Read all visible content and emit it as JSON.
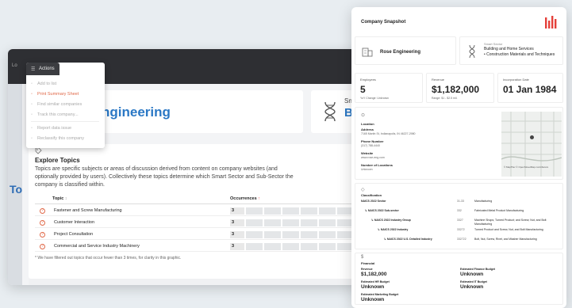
{
  "back": {
    "topbar_text": "Lo",
    "side_letter": "To",
    "company_name_partial": "ngineering",
    "sector_label_partial": "Sn",
    "sector_value_partial": "Bu"
  },
  "actions": {
    "button_label": "Actions",
    "items": [
      {
        "label": "Add to list",
        "active": false
      },
      {
        "label": "Print Summary Sheet",
        "active": true
      },
      {
        "label": "Find similar companies",
        "active": false
      },
      {
        "label": "Track this company...",
        "active": false
      },
      {
        "label": "Report data issue",
        "active": false
      },
      {
        "label": "Reclassify this company",
        "active": false
      }
    ]
  },
  "topics": {
    "title": "Explore Topics",
    "description": "Topics are specific subjects or areas of discussion derived from content on company websites (and optionally provided by users). Collectively these topics determine which Smart Sector and Sub-Sector the company is classified within.",
    "col_topic": "Topic",
    "col_occurrences": "Occurrences",
    "sort_arrow": "↑",
    "rows": [
      {
        "topic": "Fastener and Screw Manufacturing",
        "count": "3"
      },
      {
        "topic": "Customer Interaction",
        "count": "3"
      },
      {
        "topic": "Project Consultation",
        "count": "3"
      },
      {
        "topic": "Commercial and Service Industry Machinery",
        "count": "3"
      }
    ],
    "footnote": "* We have filtered out topics that occur fewer than 3 times, for clarity in this graphic."
  },
  "snapshot": {
    "title": "Company Snapshot",
    "company_name": "Rose Engineering",
    "sector_small": "Smart Sector",
    "sector_value": "Building and Home Services",
    "subsector_value": "• Construction Materials and Techniques",
    "employees_label": "Employees",
    "employees_value": "5",
    "employees_sub": "YoY Change: Unknown",
    "revenue_label": "Revenue",
    "revenue_value": "$1,182,000",
    "revenue_sub": "Range: $1 - $2.5 mil.",
    "incorp_label": "Incorporation Date",
    "incorp_value": "01 Jan 1984",
    "location_label": "Location",
    "address_label": "Address",
    "address_value": "7165 Martin St, Indianapolis, IN 46227-2980",
    "phone_label": "Phone Number",
    "phone_value": "(317) 788-4440",
    "website_label": "Website",
    "website_value": "www.rose-eng.com",
    "locations_label": "Number of Locations",
    "locations_value": "Unknown",
    "map_caption": "© MapTiler © OpenStreetMap contributors",
    "classification_label": "Classification",
    "naics": [
      {
        "label": "NAICS 2022 Sector",
        "code": "31-33",
        "desc": "Manufacturing"
      },
      {
        "label": "↳ NAICS 2022 Sub-sector",
        "code": "332",
        "desc": "Fabricated Metal Product Manufacturing"
      },
      {
        "label": "↳ NAICS 2022 Industry Group",
        "code": "3327",
        "desc": "Machine Shops; Turned Product; and Screw, Nut, and Bolt Manufacturing"
      },
      {
        "label": "↳ NAICS 2022 Industry",
        "code": "33272",
        "desc": "Turned Product and Screw, Nut, and Bolt Manufacturing"
      },
      {
        "label": "↳ NAICS 2022 U.S. Detailed Industry",
        "code": "332722",
        "desc": "Bolt, Nut, Screw, Rivet, and Washer Manufacturing"
      }
    ],
    "financial_label": "Financial",
    "fin_revenue_label": "Revenue",
    "fin_revenue_value": "$1,182,000",
    "fin_finance_label": "Estimated Finance Budget",
    "fin_finance_value": "Unknown",
    "fin_hr_label": "Estimated HR Budget",
    "fin_hr_value": "Unknown",
    "fin_it_label": "Estimated IT Budget",
    "fin_it_value": "Unknown",
    "fin_mkt_label": "Estimated Marketing Budget",
    "fin_mkt_value": "Unknown"
  },
  "colors": {
    "accent": "#2b78c5",
    "action_active": "#e06a4a",
    "logo": "#e5403a"
  },
  "icons": [
    "hamburger-icon",
    "dna-icon",
    "tag-icon",
    "question-icon",
    "building-icon",
    "pin-icon",
    "company-logo-icon",
    "money-icon"
  ]
}
